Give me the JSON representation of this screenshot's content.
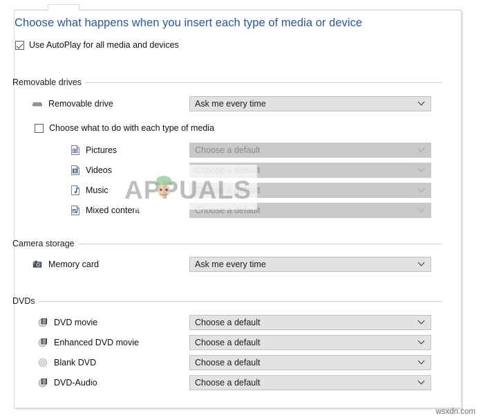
{
  "window": {
    "heading": "Choose what happens when you insert each type of media or device"
  },
  "master_checkbox": {
    "label": "Use AutoPlay for all media and devices",
    "checked": true
  },
  "sections": [
    {
      "id": "removable-drives",
      "title": "Removable drives",
      "rows": [
        {
          "label": "Removable drive",
          "icon": "usb-drive-icon",
          "combo_value": "Ask me every time",
          "disabled": false
        }
      ],
      "sub_checkbox": {
        "label": "Choose what to do with each type of media",
        "checked": false
      },
      "sub_rows": [
        {
          "label": "Pictures",
          "icon": "pictures-file-icon",
          "combo_value": "Choose a default",
          "disabled": true
        },
        {
          "label": "Videos",
          "icon": "videos-file-icon",
          "combo_value": "Choose a default",
          "disabled": true
        },
        {
          "label": "Music",
          "icon": "music-file-icon",
          "combo_value": "Choose a default",
          "disabled": true
        },
        {
          "label": "Mixed content",
          "icon": "mixed-content-file-icon",
          "combo_value": "Choose a default",
          "disabled": true
        }
      ]
    },
    {
      "id": "camera-storage",
      "title": "Camera storage",
      "rows": [
        {
          "label": "Memory card",
          "icon": "camera-icon",
          "combo_value": "Ask me every time",
          "disabled": false
        }
      ]
    },
    {
      "id": "dvds",
      "title": "DVDs",
      "rows": [
        {
          "label": "DVD movie",
          "icon": "dvd-movie-icon",
          "combo_value": "Choose a default",
          "disabled": false
        },
        {
          "label": "Enhanced DVD movie",
          "icon": "dvd-movie-icon",
          "combo_value": "Choose a default",
          "disabled": false
        },
        {
          "label": "Blank DVD",
          "icon": "blank-disc-icon",
          "combo_value": "Choose a default",
          "disabled": false
        },
        {
          "label": "DVD-Audio",
          "icon": "dvd-movie-icon",
          "combo_value": "Choose a default",
          "disabled": false
        }
      ]
    }
  ],
  "watermarks": {
    "center": "APPUALS",
    "corner": "wsxdn.com"
  },
  "colors": {
    "heading": "#2b579a",
    "combo_enabled_bg": "#e2e2e2",
    "combo_disabled_bg": "#c9c9c9",
    "divider": "#d0d0d0"
  }
}
